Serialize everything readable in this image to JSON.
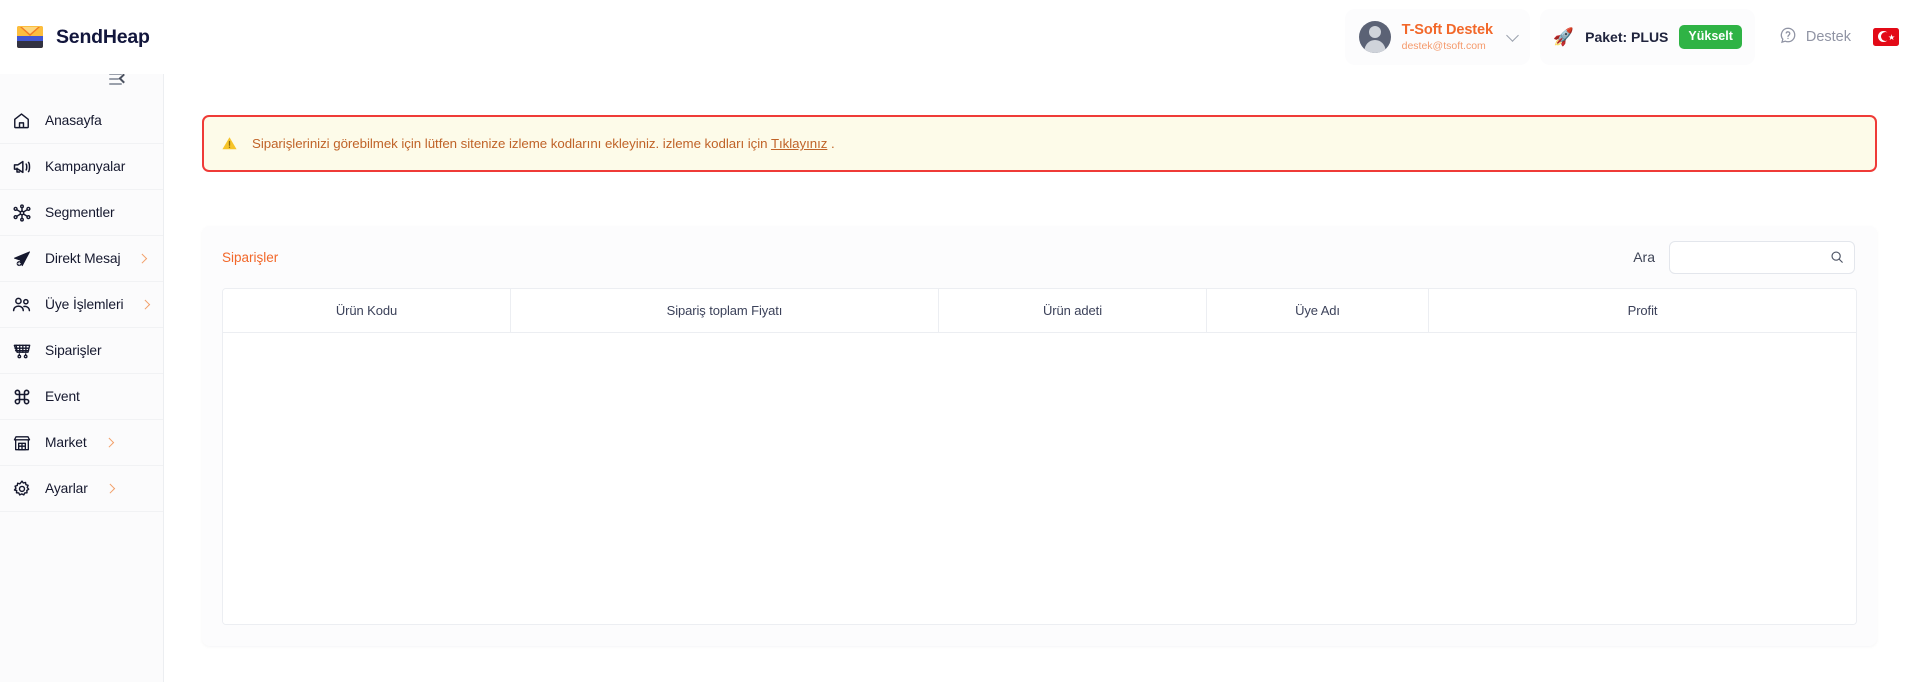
{
  "brand": {
    "name": "SendHeap",
    "logo_icon": "envelope-icon"
  },
  "header": {
    "user": {
      "name": "T-Soft Destek",
      "email": "destek@tsoft.com",
      "avatar_icon": "avatar-icon",
      "chevron_icon": "chevron-down-icon"
    },
    "package": {
      "rocket_icon": "rocket-icon",
      "label": "Paket: PLUS",
      "upgrade_label": "Yükselt",
      "upgrade_color": "#2fb345"
    },
    "support": {
      "icon": "question-circle-icon",
      "label": "Destek"
    },
    "language": {
      "flag_icon": "turkey-flag-icon",
      "code": "TR"
    }
  },
  "sidebar": {
    "collapse_icon": "collapse-sidebar-icon",
    "items": [
      {
        "label": "Anasayfa",
        "icon": "home-icon",
        "has_submenu": false
      },
      {
        "label": "Kampanyalar",
        "icon": "megaphone-icon",
        "has_submenu": false
      },
      {
        "label": "Segmentler",
        "icon": "segments-icon",
        "has_submenu": false
      },
      {
        "label": "Direkt Mesaj",
        "icon": "send-icon",
        "has_submenu": true
      },
      {
        "label": "Üye İşlemleri",
        "icon": "users-icon",
        "has_submenu": true
      },
      {
        "label": "Siparişler",
        "icon": "cart-icon",
        "has_submenu": false
      },
      {
        "label": "Event",
        "icon": "command-icon",
        "has_submenu": false
      },
      {
        "label": "Market",
        "icon": "store-icon",
        "has_submenu": true
      },
      {
        "label": "Ayarlar",
        "icon": "gear-icon",
        "has_submenu": true
      }
    ]
  },
  "alert": {
    "icon": "warning-triangle-icon",
    "text_before": "Siparişlerinizi görebilmek için lütfen sitenize izleme kodlarını ekleyiniz. izleme kodları için",
    "link_text": "Tıklayınız",
    "text_after": ".",
    "border_color": "#ef3b37",
    "background_color": "#fdfbe9",
    "text_color": "#c06328"
  },
  "orders_card": {
    "title": "Siparişler",
    "title_color": "#f2682a",
    "search": {
      "label": "Ara",
      "value": "",
      "placeholder": "",
      "icon": "search-icon"
    },
    "table": {
      "columns": [
        "Ürün Kodu",
        "Sipariş toplam Fiyatı",
        "Ürün adeti",
        "Üye Adı",
        "Profit"
      ],
      "rows": []
    }
  }
}
